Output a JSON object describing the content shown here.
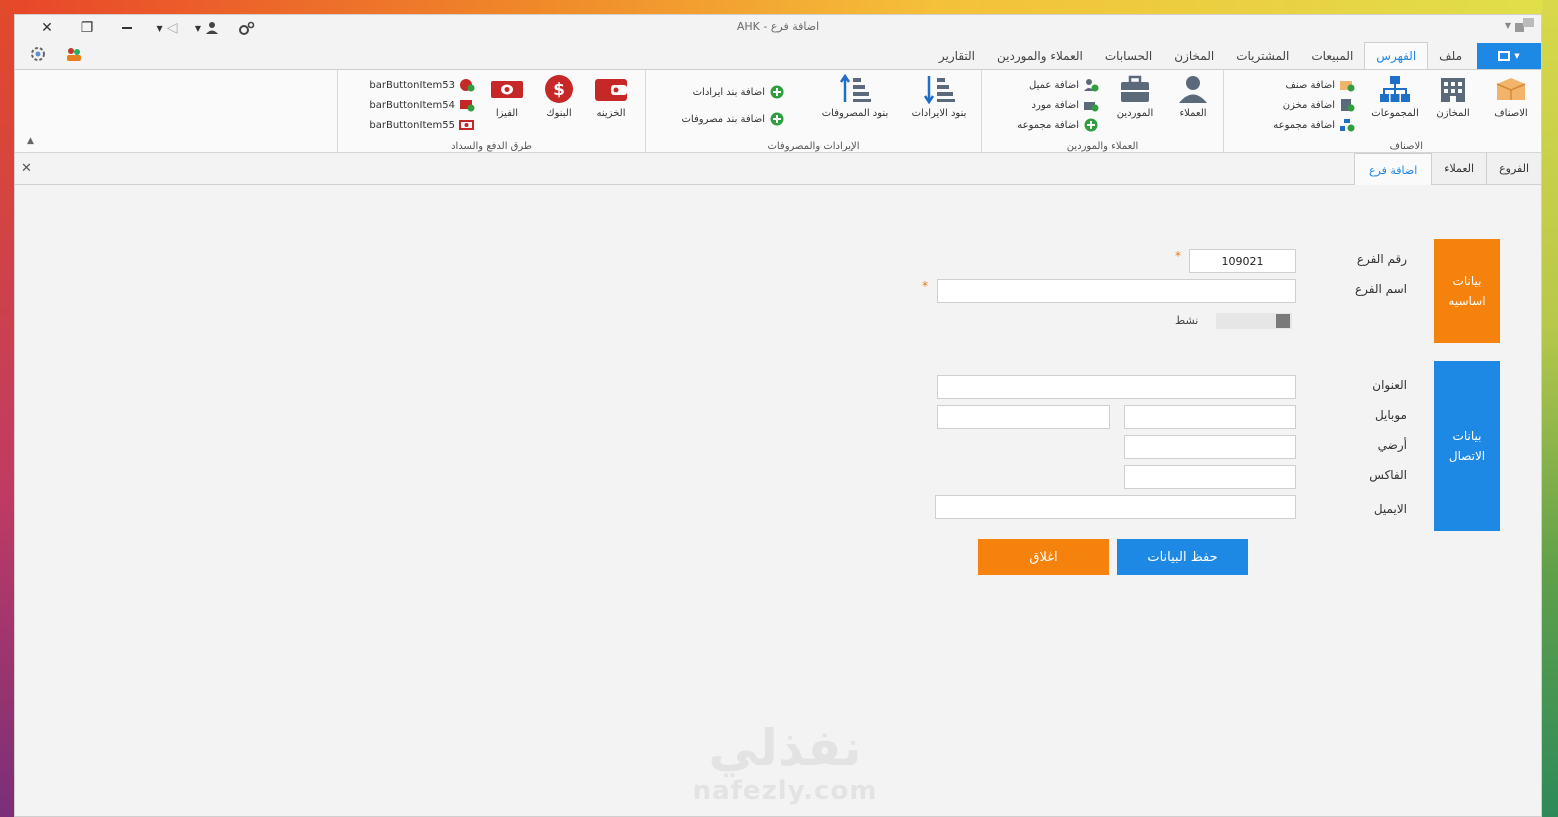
{
  "window": {
    "title": "AHK - اضافة فرع"
  },
  "quick_access": {
    "settings_icon": "gear-icon",
    "users_icon": "users-icon"
  },
  "ribbon_tabs": [
    {
      "label": "ملف"
    },
    {
      "label": "الفهرس",
      "active": true
    },
    {
      "label": "المبيعات"
    },
    {
      "label": "المشتريات"
    },
    {
      "label": "المخازن"
    },
    {
      "label": "الحسابات"
    },
    {
      "label": "العملاء والموردين"
    },
    {
      "label": "التقارير"
    }
  ],
  "ribbon": {
    "groups": {
      "items": "الاصناف",
      "customers": "العملاء والموردين",
      "income_expense": "الإيرادات والمصروفات",
      "payment": "طرق الدفع والسداد"
    },
    "items_group": {
      "products": "الاصناف",
      "stores": "المخازن",
      "groups": "المجموعات",
      "add_product": "اضافة صنف",
      "add_store": "اضافة مخزن",
      "add_group": "اضافة مجموعه"
    },
    "customers_group": {
      "customers": "العملاء",
      "suppliers": "الموردين",
      "add_customer": "اضافة عميل",
      "add_supplier": "اضافة مورد",
      "add_group": "اضافة مجموعه"
    },
    "income_group": {
      "income_items": "بنود الايرادات",
      "expense_items": "بنود المصروفات",
      "add_income": "اضافة بند ايرادات",
      "add_expense": "اضافة بند مصروفات"
    },
    "payment_group": {
      "treasury": "الخزينه",
      "banks": "البنوك",
      "visa": "الفيزا",
      "item53": "barButtonItem53",
      "item54": "barButtonItem54",
      "item55": "barButtonItem55"
    }
  },
  "doc_tabs": [
    {
      "label": "الفروع"
    },
    {
      "label": "العملاء"
    },
    {
      "label": "اضافة فرع",
      "active": true
    }
  ],
  "form": {
    "basic_block": "بيانات اساسيه",
    "contact_block": "بيانات الاتصال",
    "branch_no_label": "رقم الفرع",
    "branch_no_value": "109021",
    "branch_name_label": "اسم الفرع",
    "branch_name_value": "",
    "active_label": "نشط",
    "address_label": "العنوان",
    "mobile_label": "موبايل",
    "landline_label": "أرضي",
    "fax_label": "الفاكس",
    "email_label": "الايميل",
    "required_mark": "*",
    "colors": {
      "orange": "#f5820d",
      "blue": "#1e88e5"
    }
  },
  "actions": {
    "save": "حفظ البيانات",
    "close": "اغلاق"
  },
  "watermark": {
    "line1": "نفذلي",
    "line2": "nafezly.com"
  }
}
